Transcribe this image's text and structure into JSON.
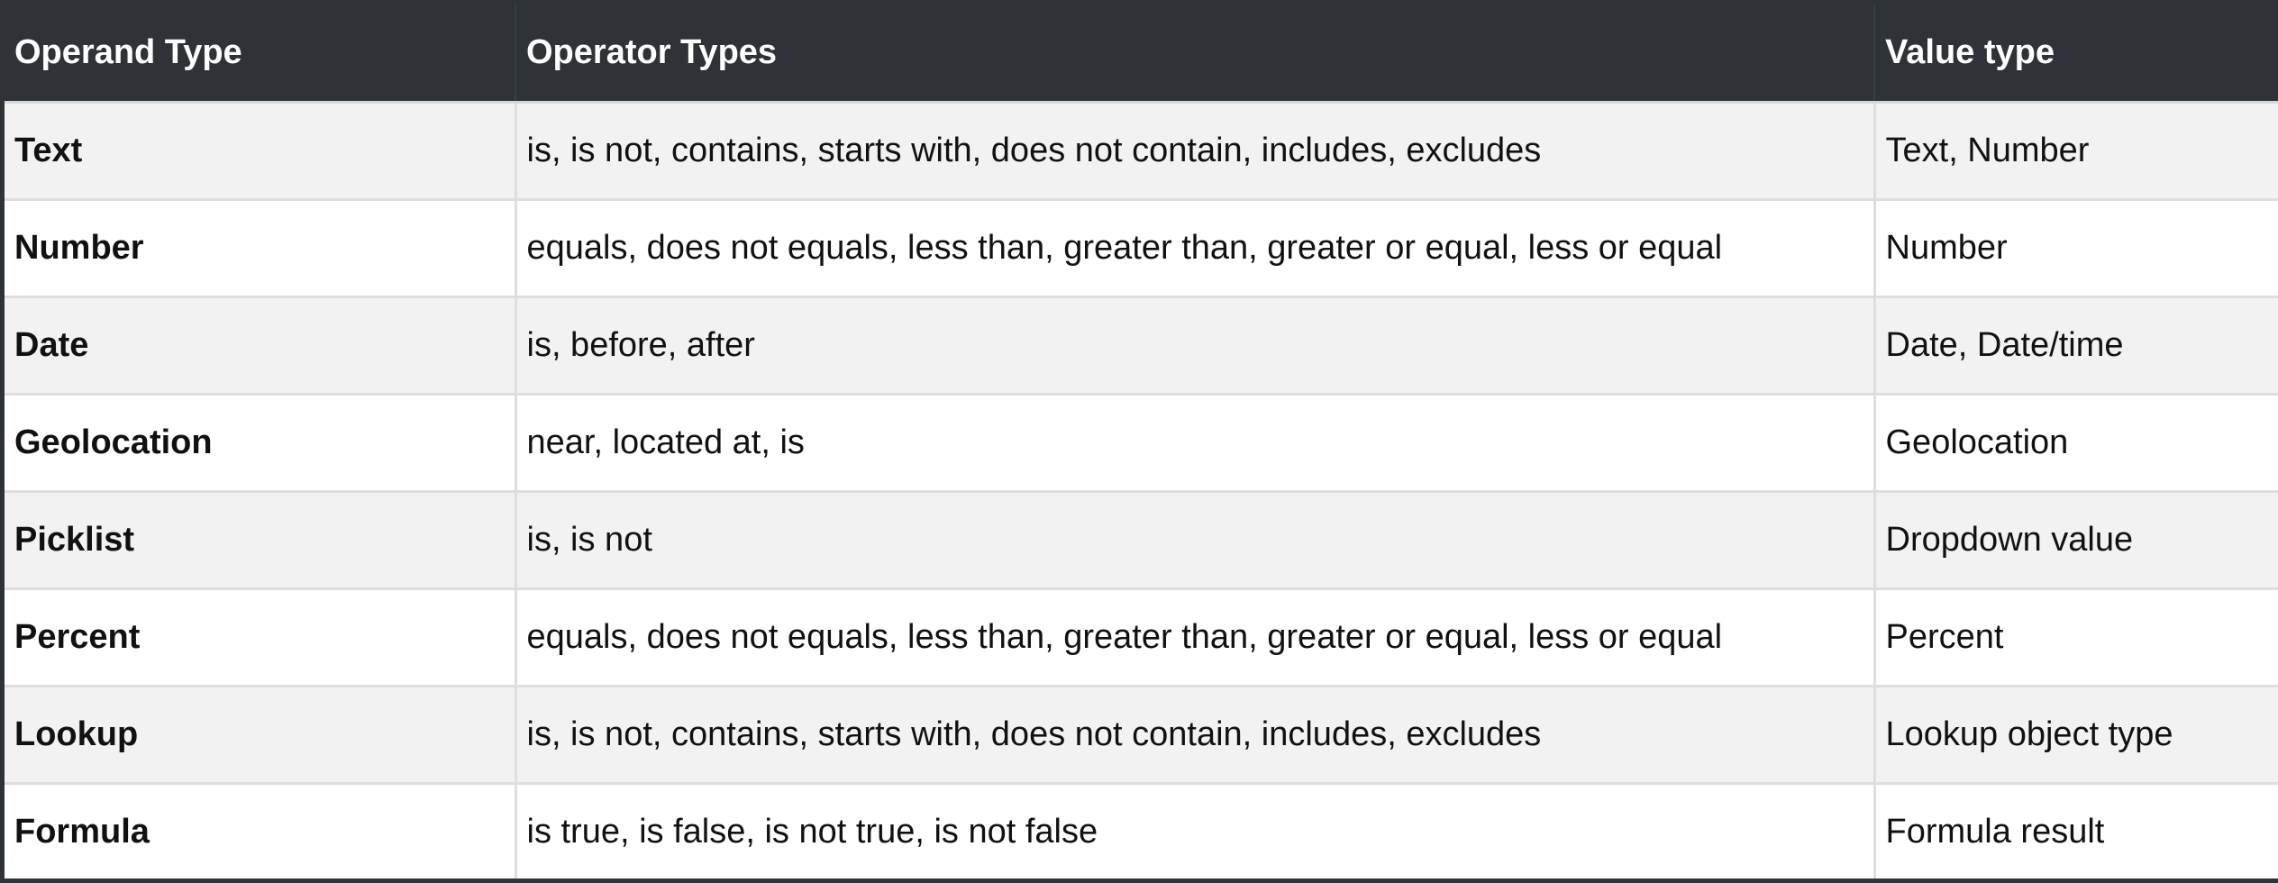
{
  "table": {
    "headers": [
      "Operand Type",
      "Operator Types",
      "Value type"
    ],
    "rows": [
      {
        "operand": "Text",
        "operators": "is, is not, contains, starts with, does not contain, includes, excludes",
        "value_type": "Text, Number"
      },
      {
        "operand": "Number",
        "operators": "equals, does not equals, less than, greater than, greater or equal, less or equal",
        "value_type": "Number"
      },
      {
        "operand": "Date",
        "operators": "is, before, after",
        "value_type": "Date, Date/time"
      },
      {
        "operand": "Geolocation",
        "operators": "near, located at, is",
        "value_type": "Geolocation"
      },
      {
        "operand": "Picklist",
        "operators": "is, is not",
        "value_type": "Dropdown value"
      },
      {
        "operand": "Percent",
        "operators": "equals, does not equals, less than, greater than, greater or equal, less or equal",
        "value_type": "Percent"
      },
      {
        "operand": "Lookup",
        "operators": "is, is not, contains, starts with, does not contain, includes, excludes",
        "value_type": "Lookup object type"
      },
      {
        "operand": "Formula",
        "operators": "is true, is false, is not true, is not false",
        "value_type": "Formula result"
      }
    ]
  },
  "colors": {
    "header_background": "#2f3337",
    "header_text": "#ffffff",
    "row_odd": "#f2f2f2",
    "row_even": "#ffffff",
    "grid_line": "#dedede"
  }
}
